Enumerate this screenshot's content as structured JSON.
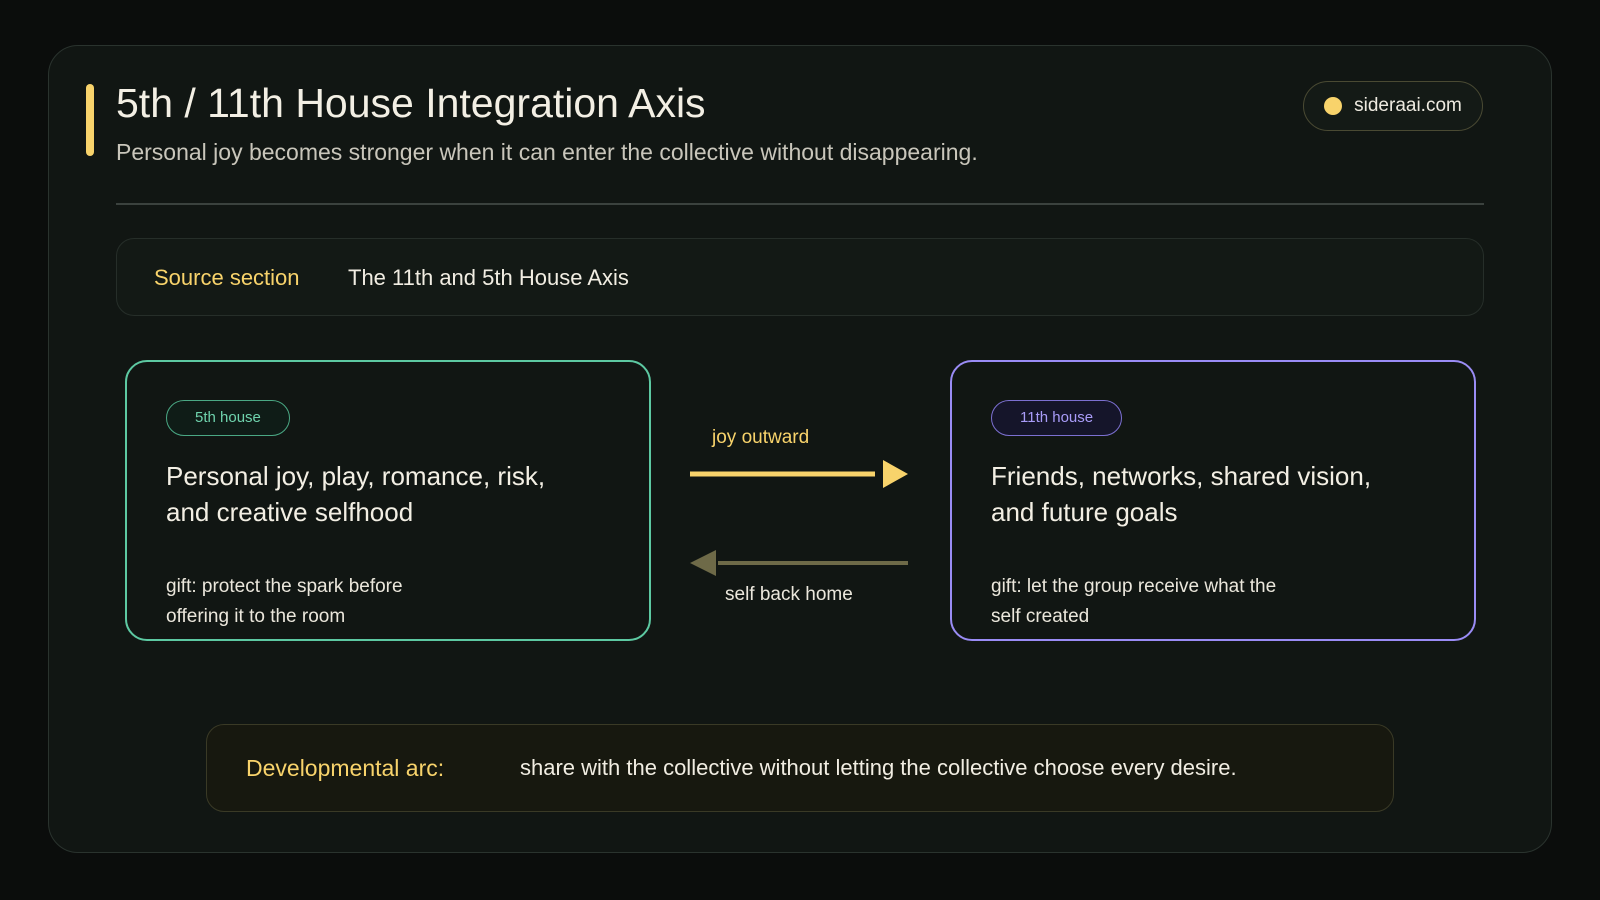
{
  "header": {
    "title": "5th / 11th House Integration Axis",
    "subtitle": "Personal joy becomes stronger when it can enter the collective without disappearing.",
    "brand": "sideraai.com"
  },
  "source": {
    "label": "Source section",
    "value": "The 11th and 5th House Axis"
  },
  "houses": [
    {
      "tag": "5th house",
      "heading": "Personal joy, play, romance, risk, and creative selfhood",
      "gift": "gift: protect the spark before offering it to the room",
      "color": "#5dc9a2"
    },
    {
      "tag": "11th house",
      "heading": "Friends, networks, shared vision, and future goals",
      "gift": "gift: let the group receive what the self created",
      "color": "#9a8cf5"
    }
  ],
  "arrows": {
    "outward_label": "joy outward",
    "outward_color": "#f8d36b",
    "back_label": "self back home",
    "back_color": "#6e6a48"
  },
  "arc": {
    "label": "Developmental arc:",
    "text": "share with the collective without letting the collective choose every desire."
  },
  "colors": {
    "accent": "#f8d36b",
    "background": "#0b0d0c",
    "panel": "#111613"
  }
}
